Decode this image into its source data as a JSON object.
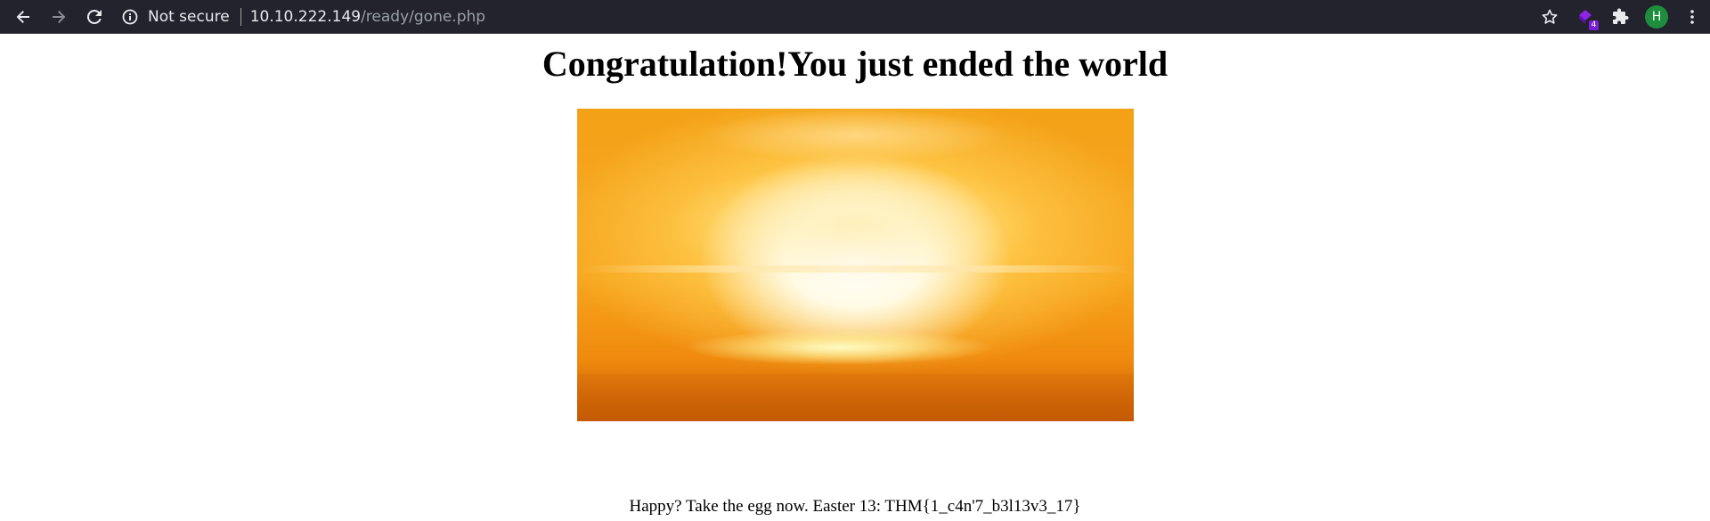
{
  "browser": {
    "security_label": "Not secure",
    "url_host": "10.10.222.149",
    "url_path": "/ready/gone.php",
    "extension_badge": "4",
    "profile_initial": "H",
    "icons": [
      "back-arrow-icon",
      "forward-arrow-icon",
      "reload-icon",
      "info-icon",
      "star-icon",
      "extension-icon",
      "puzzle-icon",
      "more-vert-icon"
    ],
    "colors": {
      "toolbar_bg": "#23232d",
      "avatar_bg": "#1e8e3e",
      "badge_bg": "#7b1fd6"
    }
  },
  "page": {
    "title": "Congratulation!You just ended the world",
    "image_subject": "explosion",
    "egg_text": "Happy? Take the egg now. Easter 13: THM{1_c4n'7_b3l13v3_17}"
  }
}
